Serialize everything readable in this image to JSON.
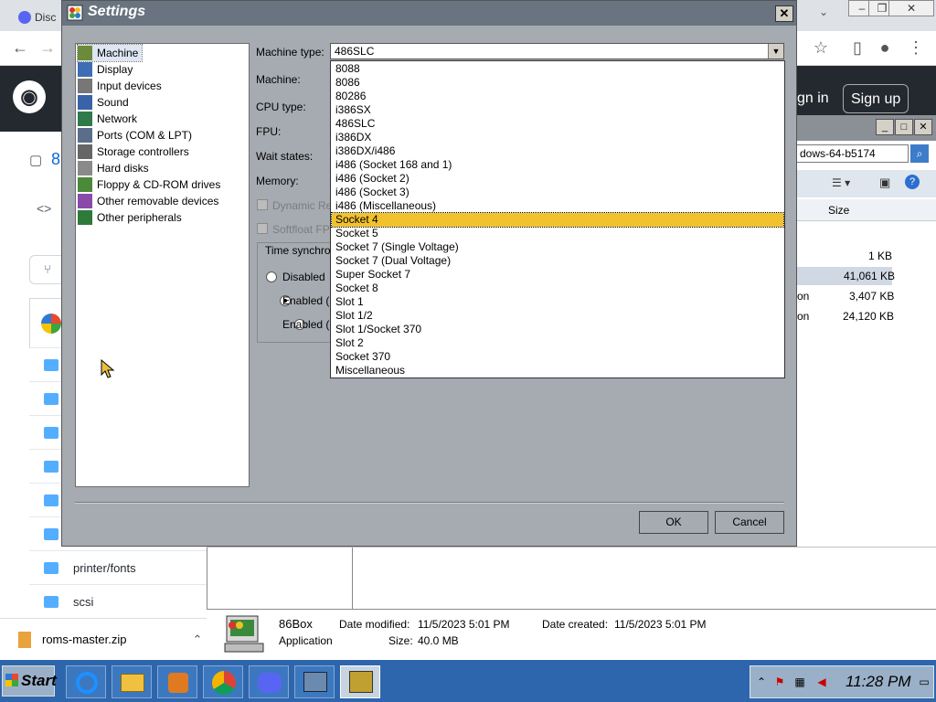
{
  "browser": {
    "tab_label": "Disc",
    "signin_label": "gn in",
    "signup_label": "Sign up"
  },
  "github": {
    "repo_fragment": "8",
    "files": [
      {
        "name": ""
      },
      {
        "name": ""
      },
      {
        "name": ""
      },
      {
        "name": ""
      },
      {
        "name": ""
      },
      {
        "name": ""
      },
      {
        "name": "printer/fonts"
      },
      {
        "name": "scsi"
      }
    ],
    "download": "roms-master.zip"
  },
  "explorer": {
    "address": "dows-64-b5174",
    "col_size": "Size",
    "rows": [
      {
        "suffix": "",
        "size": "1 KB"
      },
      {
        "suffix": "",
        "size": "41,061 KB"
      },
      {
        "suffix": "on",
        "size": "3,407 KB"
      },
      {
        "suffix": "on",
        "size": "24,120 KB"
      }
    ],
    "details": {
      "name": "86Box",
      "type": "Application",
      "modified_label": "Date modified:",
      "modified": "11/5/2023 5:01 PM",
      "created_label": "Date created:",
      "created": "11/5/2023 5:01 PM",
      "size_label": "Size:",
      "size": "40.0 MB"
    }
  },
  "settings": {
    "title": "Settings",
    "categories": [
      {
        "label": "Machine",
        "icon": "machine-icon",
        "color": "#6c8a3c"
      },
      {
        "label": "Display",
        "icon": "display-icon",
        "color": "#3d6db5"
      },
      {
        "label": "Input devices",
        "icon": "keyboard-icon",
        "color": "#777777"
      },
      {
        "label": "Sound",
        "icon": "speaker-icon",
        "color": "#3a62a8"
      },
      {
        "label": "Network",
        "icon": "network-icon",
        "color": "#2e7a4a"
      },
      {
        "label": "Ports (COM & LPT)",
        "icon": "ports-icon",
        "color": "#5a6e8a"
      },
      {
        "label": "Storage controllers",
        "icon": "storage-icon",
        "color": "#666666"
      },
      {
        "label": "Hard disks",
        "icon": "hard-disk-icon",
        "color": "#8a8a8a"
      },
      {
        "label": "Floppy & CD-ROM drives",
        "icon": "floppy-icon",
        "color": "#4a8a3a"
      },
      {
        "label": "Other removable devices",
        "icon": "removable-icon",
        "color": "#8a4aa8"
      },
      {
        "label": "Other peripherals",
        "icon": "peripherals-icon",
        "color": "#2e7a3a"
      }
    ],
    "fields": {
      "machine_type_label": "Machine type:",
      "machine_label": "Machine:",
      "cpu_type_label": "CPU type:",
      "fpu_label": "FPU:",
      "wait_states_label": "Wait states:",
      "memory_label": "Memory:",
      "dynamic_recompiler": "Dynamic Re",
      "softfloat": "Softfloat FP",
      "time_sync_title": "Time synchro",
      "radio_disabled": "Disabled",
      "radio_enabled_1": "Enabled (l",
      "radio_enabled_2": "Enabled (U"
    },
    "machine_type": {
      "selected_value": "486SLC",
      "highlighted": "Socket 4",
      "options": [
        "8088",
        "8086",
        "80286",
        "i386SX",
        "486SLC",
        "i386DX",
        "i386DX/i486",
        "i486 (Socket 168 and 1)",
        "i486 (Socket 2)",
        "i486 (Socket 3)",
        "i486 (Miscellaneous)",
        "Socket 4",
        "Socket 5",
        "Socket 7 (Single Voltage)",
        "Socket 7 (Dual Voltage)",
        "Super Socket 7",
        "Socket 8",
        "Slot 1",
        "Slot 1/2",
        "Slot 1/Socket 370",
        "Slot 2",
        "Socket 370",
        "Miscellaneous"
      ]
    },
    "ok_label": "OK",
    "cancel_label": "Cancel"
  },
  "taskbar": {
    "start_label": "Start",
    "clock": "11:28 PM",
    "apps": [
      {
        "icon": "internet-explorer-icon",
        "color": "#1e90ff"
      },
      {
        "icon": "file-explorer-icon",
        "color": "#f0c040"
      },
      {
        "icon": "media-player-icon",
        "color": "#e07a20"
      },
      {
        "icon": "chrome-icon",
        "color": "#db4437"
      },
      {
        "icon": "discord-icon",
        "color": "#5865f2"
      },
      {
        "icon": "network-manager-icon",
        "color": "#6a8ab0"
      },
      {
        "icon": "86box-icon",
        "color": "#c0a030"
      }
    ]
  }
}
